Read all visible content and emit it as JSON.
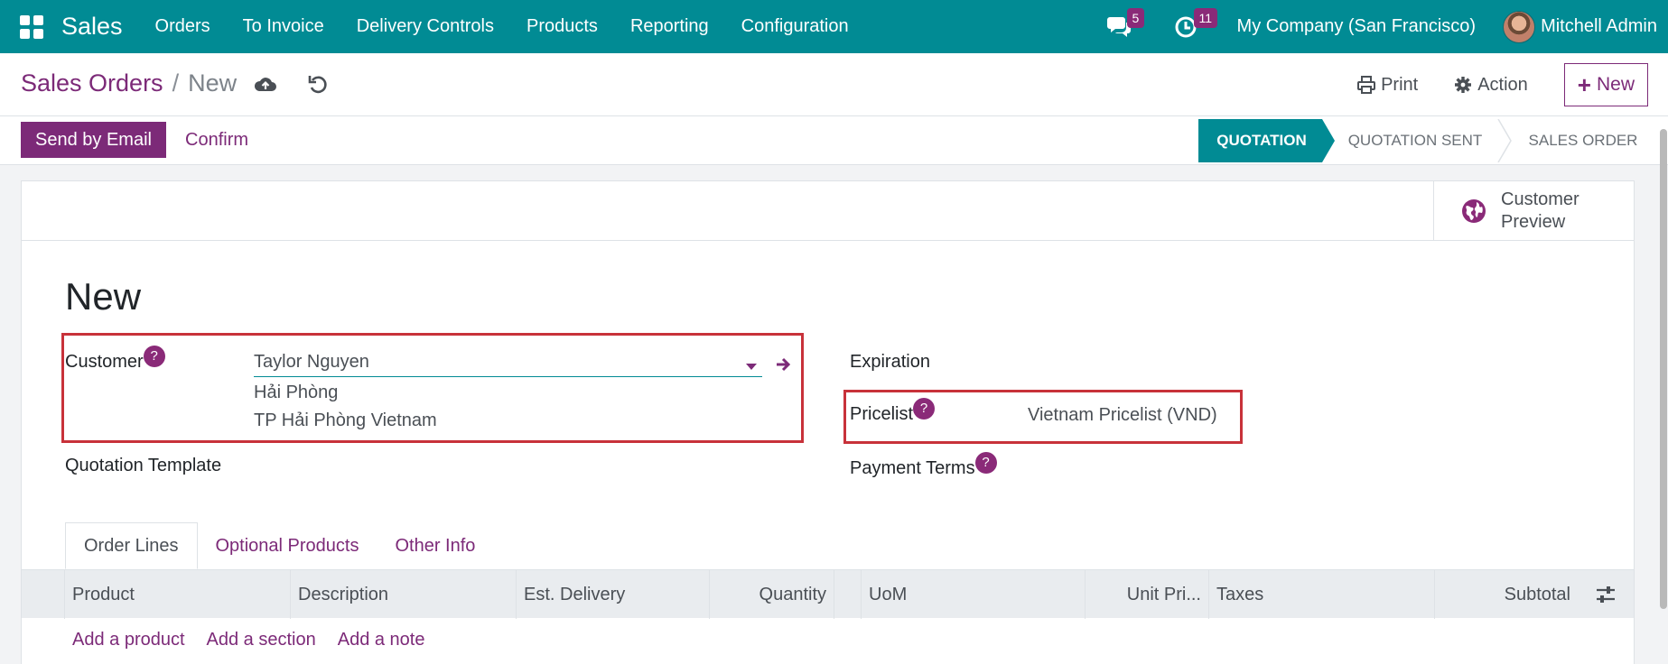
{
  "navbar": {
    "app_name": "Sales",
    "menu": [
      "Orders",
      "To Invoice",
      "Delivery Controls",
      "Products",
      "Reporting",
      "Configuration"
    ],
    "messages_count": "5",
    "activities_count": "11",
    "company": "My Company (San Francisco)",
    "user": "Mitchell Admin"
  },
  "breadcrumb": {
    "parent": "Sales Orders",
    "separator": "/",
    "current": "New"
  },
  "control": {
    "print_label": "Print",
    "action_label": "Action",
    "new_label": "New"
  },
  "actions": {
    "send_email": "Send by Email",
    "confirm": "Confirm"
  },
  "statusbar": {
    "stages": [
      "QUOTATION",
      "QUOTATION SENT",
      "SALES ORDER"
    ],
    "active": "QUOTATION"
  },
  "smart_button": {
    "line1": "Customer",
    "line2": "Preview"
  },
  "form": {
    "title": "New",
    "customer_label": "Customer",
    "customer_value": "Taylor Nguyen",
    "customer_address_1": "Hải Phòng",
    "customer_address_2": "TP Hải Phòng Vietnam",
    "quotation_template_label": "Quotation Template",
    "expiration_label": "Expiration",
    "pricelist_label": "Pricelist",
    "pricelist_value": "Vietnam Pricelist (VND)",
    "payment_terms_label": "Payment Terms",
    "help_mark": "?"
  },
  "tabs": [
    "Order Lines",
    "Optional Products",
    "Other Info"
  ],
  "table": {
    "columns": [
      "Product",
      "Description",
      "Est. Delivery",
      "Quantity",
      "UoM",
      "Unit Pri...",
      "Taxes",
      "Subtotal"
    ],
    "add_product": "Add a product",
    "add_section": "Add a section",
    "add_note": "Add a note"
  },
  "colors": {
    "navbar": "#018b94",
    "primary": "#7c2a78",
    "highlight_box": "#c8323a"
  }
}
